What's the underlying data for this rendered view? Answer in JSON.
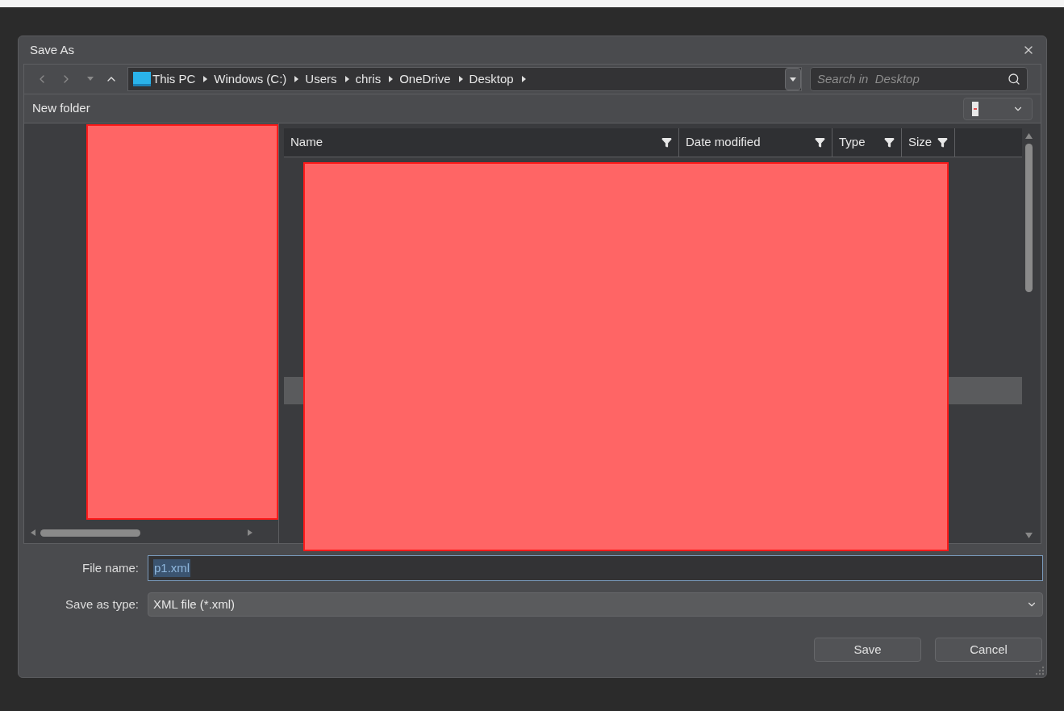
{
  "window": {
    "title": "Save As"
  },
  "breadcrumb": [
    "This PC",
    "Windows (C:)",
    "Users",
    "chris",
    "OneDrive",
    "Desktop"
  ],
  "search": {
    "placeholder": "Search in  Desktop"
  },
  "toolbar": {
    "new_folder": "New folder"
  },
  "columns": [
    "Name",
    "Date modified",
    "Type",
    "Size"
  ],
  "file_name": {
    "label": "File name:",
    "value": "p1.xml"
  },
  "save_type": {
    "label": "Save as type:",
    "value": "XML file (*.xml)"
  },
  "buttons": [
    "Save",
    "Cancel"
  ]
}
